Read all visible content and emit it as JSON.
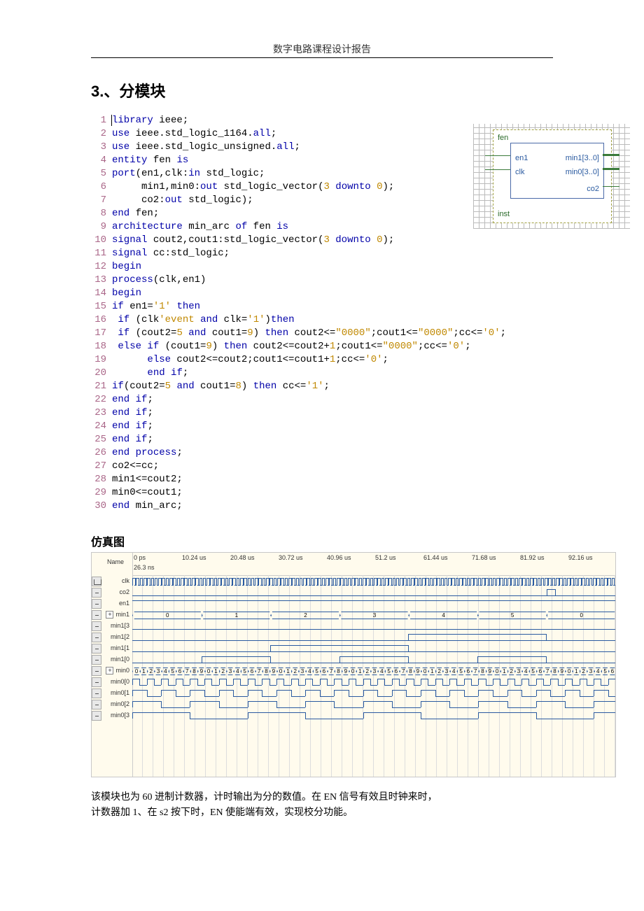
{
  "header": {
    "title": "数字电路课程设计报告"
  },
  "section": {
    "title": "3.、分模块"
  },
  "code": {
    "lines": [
      {
        "n": 1,
        "tokens": [
          [
            "kw",
            "library"
          ],
          [
            "id",
            " ieee;"
          ]
        ]
      },
      {
        "n": 2,
        "tokens": [
          [
            "kw",
            "use"
          ],
          [
            "id",
            " ieee.std_logic_1164."
          ],
          [
            "kw",
            "all"
          ],
          [
            "id",
            ";"
          ]
        ]
      },
      {
        "n": 3,
        "tokens": [
          [
            "kw",
            "use"
          ],
          [
            "id",
            " ieee.std_logic_unsigned."
          ],
          [
            "kw",
            "all"
          ],
          [
            "id",
            ";"
          ]
        ]
      },
      {
        "n": 4,
        "tokens": [
          [
            "kw",
            "entity"
          ],
          [
            "id",
            " fen "
          ],
          [
            "kw",
            "is"
          ]
        ]
      },
      {
        "n": 5,
        "tokens": [
          [
            "kw",
            "port"
          ],
          [
            "id",
            "(en1,clk:"
          ],
          [
            "kw",
            "in"
          ],
          [
            "id",
            " std_logic;"
          ]
        ]
      },
      {
        "n": 6,
        "tokens": [
          [
            "id",
            "     min1,min0:"
          ],
          [
            "kw",
            "out"
          ],
          [
            "id",
            " std_logic_vector("
          ],
          [
            "num",
            "3"
          ],
          [
            "id",
            " "
          ],
          [
            "kw",
            "downto"
          ],
          [
            "id",
            " "
          ],
          [
            "num",
            "0"
          ],
          [
            "id",
            ");"
          ]
        ]
      },
      {
        "n": 7,
        "tokens": [
          [
            "id",
            "     co2:"
          ],
          [
            "kw",
            "out"
          ],
          [
            "id",
            " std_logic);"
          ]
        ]
      },
      {
        "n": 8,
        "tokens": [
          [
            "kw",
            "end"
          ],
          [
            "id",
            " fen;"
          ]
        ]
      },
      {
        "n": 9,
        "tokens": [
          [
            "kw",
            "architecture"
          ],
          [
            "id",
            " min_arc "
          ],
          [
            "kw",
            "of"
          ],
          [
            "id",
            " fen "
          ],
          [
            "kw",
            "is"
          ]
        ]
      },
      {
        "n": 10,
        "tokens": [
          [
            "kw",
            "signal"
          ],
          [
            "id",
            " cout2,cout1:std_logic_vector("
          ],
          [
            "num",
            "3"
          ],
          [
            "id",
            " "
          ],
          [
            "kw",
            "downto"
          ],
          [
            "id",
            " "
          ],
          [
            "num",
            "0"
          ],
          [
            "id",
            ");"
          ]
        ]
      },
      {
        "n": 11,
        "tokens": [
          [
            "kw",
            "signal"
          ],
          [
            "id",
            " cc:std_logic;"
          ]
        ]
      },
      {
        "n": 12,
        "tokens": [
          [
            "kw",
            "begin"
          ]
        ]
      },
      {
        "n": 13,
        "tokens": [
          [
            "kw",
            "process"
          ],
          [
            "id",
            "(clk,en1)"
          ]
        ]
      },
      {
        "n": 14,
        "tokens": [
          [
            "kw",
            "begin"
          ]
        ]
      },
      {
        "n": 15,
        "tokens": [
          [
            "kw",
            "if"
          ],
          [
            "id",
            " en1="
          ],
          [
            "str",
            "'1'"
          ],
          [
            "id",
            " "
          ],
          [
            "kw",
            "then"
          ]
        ]
      },
      {
        "n": 16,
        "tokens": [
          [
            "id",
            " "
          ],
          [
            "kw",
            "if"
          ],
          [
            "id",
            " (clk"
          ],
          [
            "str",
            "'event"
          ],
          [
            "id",
            " "
          ],
          [
            "kw",
            "and"
          ],
          [
            "id",
            " clk="
          ],
          [
            "str",
            "'1'"
          ],
          [
            "id",
            ")"
          ],
          [
            "kw",
            "then"
          ]
        ]
      },
      {
        "n": 17,
        "tokens": [
          [
            "id",
            " "
          ],
          [
            "kw",
            "if"
          ],
          [
            "id",
            " (cout2="
          ],
          [
            "num",
            "5"
          ],
          [
            "id",
            " "
          ],
          [
            "kw",
            "and"
          ],
          [
            "id",
            " cout1="
          ],
          [
            "num",
            "9"
          ],
          [
            "id",
            ") "
          ],
          [
            "kw",
            "then"
          ],
          [
            "id",
            " cout2<="
          ],
          [
            "str",
            "\"0000\""
          ],
          [
            "id",
            ";cout1<="
          ],
          [
            "str",
            "\"0000\""
          ],
          [
            "id",
            ";cc<="
          ],
          [
            "str",
            "'0'"
          ],
          [
            "id",
            ";"
          ]
        ]
      },
      {
        "n": 18,
        "tokens": [
          [
            "id",
            " "
          ],
          [
            "kw",
            "else"
          ],
          [
            "id",
            " "
          ],
          [
            "kw",
            "if"
          ],
          [
            "id",
            " (cout1="
          ],
          [
            "num",
            "9"
          ],
          [
            "id",
            ") "
          ],
          [
            "kw",
            "then"
          ],
          [
            "id",
            " cout2<=cout2+"
          ],
          [
            "num",
            "1"
          ],
          [
            "id",
            ";cout1<="
          ],
          [
            "str",
            "\"0000\""
          ],
          [
            "id",
            ";cc<="
          ],
          [
            "str",
            "'0'"
          ],
          [
            "id",
            ";"
          ]
        ]
      },
      {
        "n": 19,
        "tokens": [
          [
            "id",
            "      "
          ],
          [
            "kw",
            "else"
          ],
          [
            "id",
            " cout2<=cout2;cout1<=cout1+"
          ],
          [
            "num",
            "1"
          ],
          [
            "id",
            ";cc<="
          ],
          [
            "str",
            "'0'"
          ],
          [
            "id",
            ";"
          ]
        ]
      },
      {
        "n": 20,
        "tokens": [
          [
            "id",
            "      "
          ],
          [
            "kw",
            "end"
          ],
          [
            "id",
            " "
          ],
          [
            "kw",
            "if"
          ],
          [
            "id",
            ";"
          ]
        ]
      },
      {
        "n": 21,
        "tokens": [
          [
            "kw",
            "if"
          ],
          [
            "id",
            "(cout2="
          ],
          [
            "num",
            "5"
          ],
          [
            "id",
            " "
          ],
          [
            "kw",
            "and"
          ],
          [
            "id",
            " cout1="
          ],
          [
            "num",
            "8"
          ],
          [
            "id",
            ") "
          ],
          [
            "kw",
            "then"
          ],
          [
            "id",
            " cc<="
          ],
          [
            "str",
            "'1'"
          ],
          [
            "id",
            ";"
          ]
        ]
      },
      {
        "n": 22,
        "tokens": [
          [
            "kw",
            "end"
          ],
          [
            "id",
            " "
          ],
          [
            "kw",
            "if"
          ],
          [
            "id",
            ";"
          ]
        ]
      },
      {
        "n": 23,
        "tokens": [
          [
            "kw",
            "end"
          ],
          [
            "id",
            " "
          ],
          [
            "kw",
            "if"
          ],
          [
            "id",
            ";"
          ]
        ]
      },
      {
        "n": 24,
        "tokens": [
          [
            "kw",
            "end"
          ],
          [
            "id",
            " "
          ],
          [
            "kw",
            "if"
          ],
          [
            "id",
            ";"
          ]
        ]
      },
      {
        "n": 25,
        "tokens": [
          [
            "kw",
            "end"
          ],
          [
            "id",
            " "
          ],
          [
            "kw",
            "if"
          ],
          [
            "id",
            ";"
          ]
        ]
      },
      {
        "n": 26,
        "tokens": [
          [
            "kw",
            "end"
          ],
          [
            "id",
            " "
          ],
          [
            "kw",
            "process"
          ],
          [
            "id",
            ";"
          ]
        ]
      },
      {
        "n": 27,
        "tokens": [
          [
            "id",
            "co2<=cc;"
          ]
        ]
      },
      {
        "n": 28,
        "tokens": [
          [
            "id",
            "min1<=cout2;"
          ]
        ]
      },
      {
        "n": 29,
        "tokens": [
          [
            "id",
            "min0<=cout1;"
          ]
        ]
      },
      {
        "n": 30,
        "tokens": [
          [
            "kw",
            "end"
          ],
          [
            "id",
            " min_arc;"
          ]
        ]
      }
    ]
  },
  "block": {
    "title": "fen",
    "inst": "inst",
    "ports_left": [
      "en1",
      "clk"
    ],
    "ports_right": [
      "min1[3..0]",
      "min0[3..0]",
      "co2"
    ]
  },
  "sim": {
    "heading": "仿真图",
    "time_cursor": "26.3 ns",
    "name_header": "Name",
    "ticks": [
      "0 ps",
      "10.24 us",
      "20.48 us",
      "30.72 us",
      "40.96 us",
      "51.2 us",
      "61.44 us",
      "71.68 us",
      "81.92 us",
      "92.16 us"
    ],
    "rows": [
      {
        "name": "clk"
      },
      {
        "name": "co2"
      },
      {
        "name": "en1"
      },
      {
        "name": "min1",
        "expand": true
      },
      {
        "name": "min1[3"
      },
      {
        "name": "min1[2"
      },
      {
        "name": "min1[1"
      },
      {
        "name": "min1[0"
      },
      {
        "name": "min0",
        "expand": true
      },
      {
        "name": "min0[0"
      },
      {
        "name": "min0[1"
      },
      {
        "name": "min0[2"
      },
      {
        "name": "min0[3"
      }
    ],
    "min1_values": [
      "0",
      "1",
      "2",
      "3",
      "4",
      "5",
      "0"
    ],
    "min0_seq": [
      "0",
      "1",
      "2",
      "3",
      "4",
      "5",
      "6",
      "7",
      "8",
      "9",
      "0",
      "1",
      "2",
      "3",
      "4",
      "5",
      "6",
      "7",
      "8",
      "9",
      "0",
      "1",
      "2",
      "3",
      "4",
      "5",
      "6",
      "7",
      "8",
      "9",
      "0",
      "1",
      "2",
      "3",
      "4",
      "5",
      "6",
      "7",
      "8",
      "9",
      "0",
      "1",
      "2",
      "3",
      "4",
      "5",
      "6",
      "7",
      "8",
      "9",
      "0",
      "1",
      "2",
      "3",
      "4",
      "5",
      "6",
      "7",
      "8",
      "9",
      "0",
      "1",
      "2",
      "3",
      "4",
      "5",
      "6"
    ]
  },
  "explain": {
    "p1": "该模块也为 60 进制计数器，计时输出为分的数值。在 EN 信号有效且时钟来时，",
    "p2": "计数器加 1、在 s2 按下时，EN 使能端有效，实现校分功能。"
  }
}
